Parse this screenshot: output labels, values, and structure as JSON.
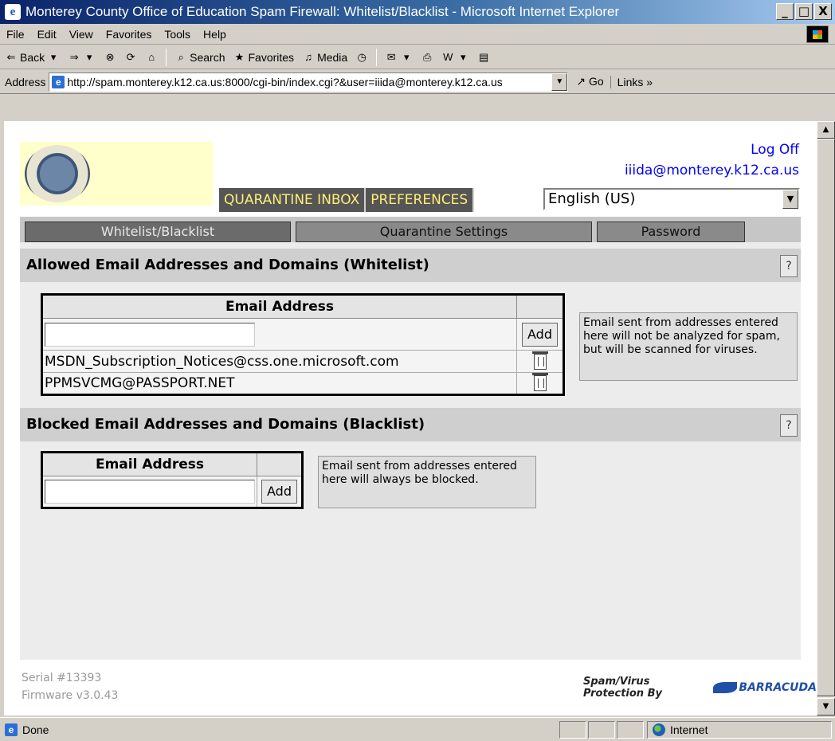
{
  "window": {
    "title": "Monterey County Office of Education Spam Firewall: Whitelist/Blacklist - Microsoft Internet Explorer",
    "app_icon": "ie-icon",
    "controls": [
      "_",
      "□",
      "X"
    ]
  },
  "menu": [
    "File",
    "Edit",
    "View",
    "Favorites",
    "Tools",
    "Help"
  ],
  "toolbar": {
    "back": "Back",
    "search": "Search",
    "favorites": "Favorites",
    "media": "Media"
  },
  "address": {
    "label": "Address",
    "url": "http://spam.monterey.k12.ca.us:8000/cgi-bin/index.cgi?&user=iiida@monterey.k12.ca.us",
    "go": "Go",
    "links": "Links"
  },
  "header": {
    "logoff": "Log Off",
    "user": "iiida@monterey.k12.ca.us",
    "nav": [
      "QUARANTINE INBOX",
      "PREFERENCES"
    ],
    "language": "English (US)"
  },
  "subtabs": {
    "whitelist": "Whitelist/Blacklist",
    "quarantine": "Quarantine Settings",
    "password": "Password"
  },
  "whitelist": {
    "heading": "Allowed Email Addresses and Domains (Whitelist)",
    "help": "?",
    "column": "Email Address",
    "add_label": "Add",
    "entries": [
      "MSDN_Subscription_Notices@css.one.microsoft.com",
      "PPMSVCMG@PASSPORT.NET"
    ],
    "note": "Email sent from addresses entered here will not be analyzed for spam, but will be scanned for viruses."
  },
  "blacklist": {
    "heading": "Blocked Email Addresses and Domains (Blacklist)",
    "help": "?",
    "column": "Email Address",
    "add_label": "Add",
    "note": "Email sent from addresses entered here will always be blocked."
  },
  "footer": {
    "serial": "Serial #13393",
    "firmware": "Firmware v3.0.43",
    "protection": "Spam/Virus Protection By",
    "brand": "BARRACUDA"
  },
  "status": {
    "text": "Done",
    "zone": "Internet"
  }
}
